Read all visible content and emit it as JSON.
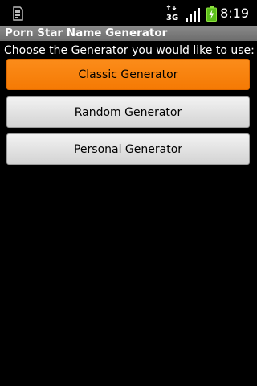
{
  "status_bar": {
    "network_label": "3G",
    "time": "8:19",
    "icons": [
      "sd-card-icon",
      "network-3g-icon",
      "signal-strength-icon",
      "battery-charging-icon"
    ]
  },
  "app": {
    "title": "Porn Star Name Generator"
  },
  "main": {
    "instruction": "Choose the Generator you would like to use:",
    "buttons": [
      {
        "label": "Classic Generator",
        "selected": true
      },
      {
        "label": "Random Generator",
        "selected": false
      },
      {
        "label": "Personal Generator",
        "selected": false
      }
    ]
  },
  "colors": {
    "background": "#000000",
    "title_bar": "#7b7b7b",
    "selected_button": "#f7820e",
    "button": "#e2e2e2"
  }
}
